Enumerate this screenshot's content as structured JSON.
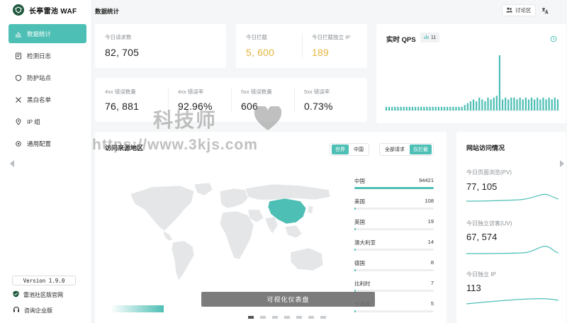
{
  "app": {
    "name": "长亭雷池 WAF"
  },
  "sidebar": {
    "items": [
      {
        "label": "数据统计",
        "icon": "bar-chart-icon",
        "active": true
      },
      {
        "label": "检测日志",
        "icon": "log-icon"
      },
      {
        "label": "防护站点",
        "icon": "shield-icon"
      },
      {
        "label": "黑白名单",
        "icon": "tools-icon"
      },
      {
        "label": "IP 组",
        "icon": "location-pin-icon"
      },
      {
        "label": "通用配置",
        "icon": "gear-icon"
      }
    ],
    "version": "Version 1.9.0",
    "community_link": "雷池社区版官网",
    "enterprise_link": "咨询企业版"
  },
  "header": {
    "title": "数据统计",
    "forum_label": "讨论区"
  },
  "stats_top": [
    {
      "label": "今日请求数",
      "value": "82, 705"
    },
    {
      "label": "今日拦截",
      "value": "5, 600"
    },
    {
      "label": "今日拦截独立 IP",
      "value": "189"
    }
  ],
  "stats_errors": [
    {
      "label": "4xx 错误数量",
      "value": "76, 881"
    },
    {
      "label": "4xx 错误率",
      "value": "92.96%"
    },
    {
      "label": "5xx 错误数量",
      "value": "606"
    },
    {
      "label": "5xx 错误率",
      "value": "0.73%"
    }
  ],
  "qps": {
    "title": "实时 QPS",
    "badge": "11",
    "accent": "#4dbfb5",
    "values": [
      2,
      2,
      2,
      2,
      2,
      2,
      2,
      2,
      2,
      2,
      2,
      2,
      2,
      2,
      2,
      2,
      2,
      2,
      2,
      2,
      2,
      2,
      2,
      2,
      2,
      2,
      2,
      3,
      4,
      5,
      6,
      5,
      7,
      6,
      5,
      7,
      6,
      7,
      8,
      30,
      6,
      7,
      6,
      7,
      7,
      6,
      7,
      6,
      7,
      6,
      7,
      6,
      7,
      6,
      7,
      6,
      7,
      6,
      7,
      6
    ]
  },
  "map": {
    "title": "访问来源地区",
    "scope_tabs": [
      {
        "label": "世界",
        "active": true
      },
      {
        "label": "中国",
        "active": false
      }
    ],
    "filter_tabs": [
      {
        "label": "全部请求",
        "active": false
      },
      {
        "label": "仅拦截",
        "active": true
      }
    ],
    "countries": [
      {
        "name": "中国",
        "count": "94421",
        "share": 1.0
      },
      {
        "name": "美国",
        "count": "108",
        "share": 0.02
      },
      {
        "name": "英国",
        "count": "19",
        "share": 0.01
      },
      {
        "name": "澳大利亚",
        "count": "14",
        "share": 0.01
      },
      {
        "name": "德国",
        "count": "8",
        "share": 0.005
      },
      {
        "name": "比利时",
        "count": "7",
        "share": 0.005
      },
      {
        "name": "土耳其",
        "count": "5",
        "share": 0.004
      }
    ]
  },
  "visits": {
    "title": "网站访问情况",
    "items": [
      {
        "label": "今日页面浏览(PV)",
        "value": "77, 105"
      },
      {
        "label": "今日独立访客(UV)",
        "value": "67, 574"
      },
      {
        "label": "今日独立 IP",
        "value": "113"
      }
    ]
  },
  "overlay": {
    "caption": "可视化仪表盘"
  },
  "watermark": {
    "line1": "科技师",
    "line2": "https://www.3kjs.com"
  }
}
